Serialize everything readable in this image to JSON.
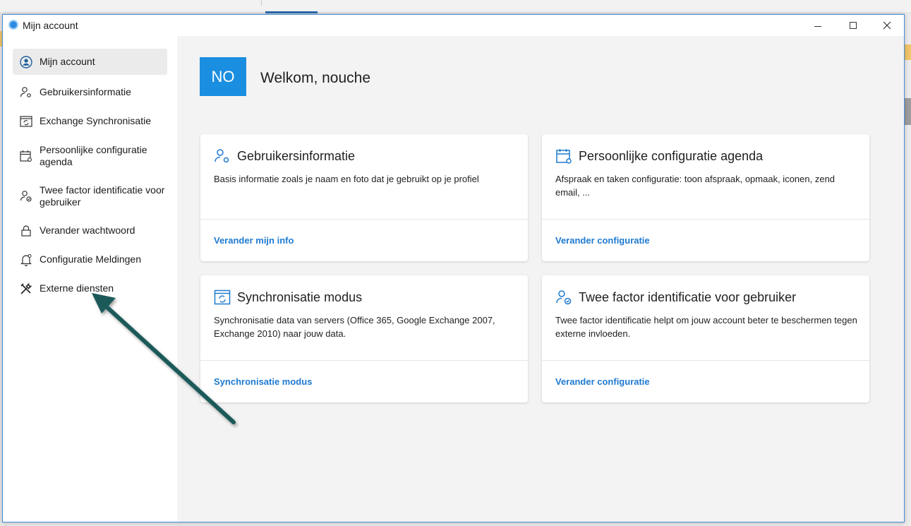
{
  "window": {
    "title": "Mijn account"
  },
  "sidebar": {
    "items": [
      {
        "label": "Mijn account",
        "icon": "user-circle-icon"
      },
      {
        "label": "Gebruikersinformatie",
        "icon": "user-settings-icon"
      },
      {
        "label": "Exchange Synchronisatie",
        "icon": "sync-window-icon"
      },
      {
        "label": "Persoonlijke configuratie agenda",
        "icon": "calendar-settings-icon"
      },
      {
        "label": "Twee factor identificatie voor gebruiker",
        "icon": "user-shield-icon"
      },
      {
        "label": "Verander wachtwoord",
        "icon": "lock-icon"
      },
      {
        "label": "Configuratie Meldingen",
        "icon": "bell-settings-icon"
      },
      {
        "label": "Externe diensten",
        "icon": "tools-icon"
      }
    ]
  },
  "main": {
    "avatar_initials": "NO",
    "welcome": "Welkom, nouche",
    "cards": [
      {
        "title": "Gebruikersinformatie",
        "description": "Basis informatie zoals je naam en foto dat je gebruikt op je profiel",
        "link": "Verander mijn info",
        "icon": "user-settings-icon"
      },
      {
        "title": "Persoonlijke configuratie agenda",
        "description": "Afspraak en taken configuratie: toon afspraak, opmaak, iconen, zend email, ...",
        "link": "Verander configuratie",
        "icon": "calendar-settings-icon"
      },
      {
        "title": "Synchronisatie modus",
        "description": "Synchronisatie data van servers (Office 365, Google Exchange 2007, Exchange 2010) naar jouw data.",
        "link": "Synchronisatie modus",
        "icon": "sync-window-icon"
      },
      {
        "title": "Twee factor identificatie voor gebruiker",
        "description": "Twee factor identificatie helpt om jouw account beter te beschermen tegen externe invloeden.",
        "link": "Verander configuratie",
        "icon": "user-shield-icon"
      }
    ]
  },
  "colors": {
    "accent": "#1a8ee0",
    "link": "#1f7ad1",
    "annotation_arrow": "#1d5a5a"
  }
}
